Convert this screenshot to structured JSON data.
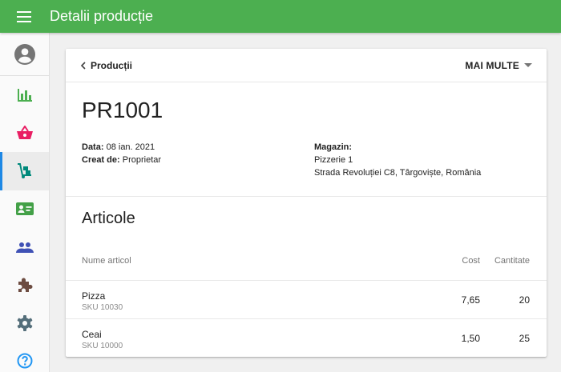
{
  "header": {
    "title": "Detalii producție"
  },
  "sidebar": {
    "items": [
      {
        "icon": "bar-chart-icon",
        "color": "#4caf50"
      },
      {
        "icon": "basket-icon",
        "color": "#e91e63"
      },
      {
        "icon": "hand-truck-icon",
        "color": "#00897b",
        "active": true
      },
      {
        "icon": "contact-card-icon",
        "color": "#43a047"
      },
      {
        "icon": "people-icon",
        "color": "#3f51b5"
      },
      {
        "icon": "puzzle-icon",
        "color": "#6d4c41"
      },
      {
        "icon": "gear-icon",
        "color": "#546e7a"
      },
      {
        "icon": "help-icon",
        "color": "#2196f3"
      }
    ]
  },
  "card": {
    "back_label": "Producții",
    "more_label": "MAI MULTE",
    "order_id": "PR1001",
    "date_label": "Data:",
    "date_value": "08 ian. 2021",
    "created_label": "Creat de:",
    "created_value": "Proprietar",
    "store_label": "Magazin:",
    "store_name": "Pizzerie 1",
    "store_address": "Strada Revoluției C8, Târgoviște, România"
  },
  "articles": {
    "title": "Articole",
    "columns": {
      "name": "Nume articol",
      "cost": "Cost",
      "quantity": "Cantitate"
    },
    "rows": [
      {
        "name": "Pizza",
        "sku": "SKU 10030",
        "cost": "7,65",
        "quantity": "20"
      },
      {
        "name": "Ceai",
        "sku": "SKU 10000",
        "cost": "1,50",
        "quantity": "25"
      }
    ]
  },
  "colors": {
    "appbar": "#4caf50",
    "active_indicator": "#1e88e5"
  }
}
